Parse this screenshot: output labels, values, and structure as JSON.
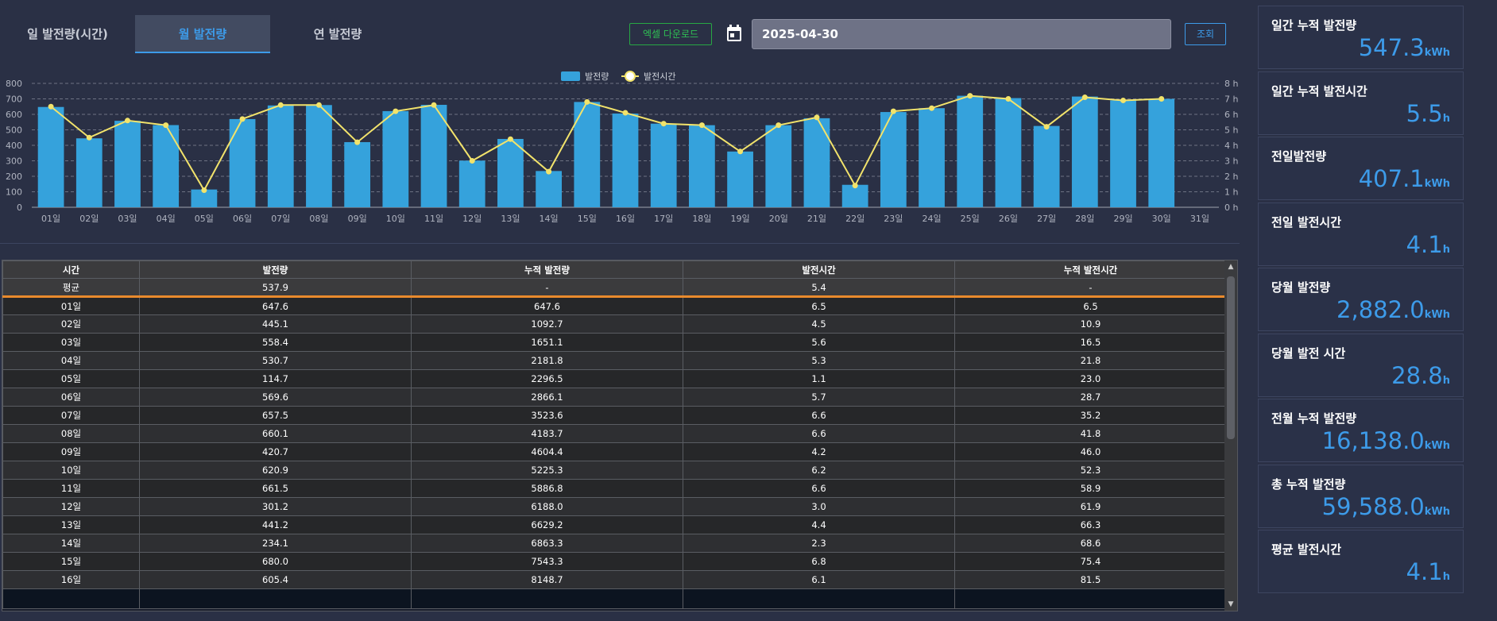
{
  "tabs": [
    "일 발전량(시간)",
    "월 발전량",
    "연 발전량"
  ],
  "toolbar": {
    "excel_label": "엑셀 다운로드",
    "date": "2025-04-30",
    "search_label": "조회"
  },
  "icons": {
    "calendar": "calendar-icon",
    "scroll_up": "chevron-up-icon",
    "scroll_down": "chevron-down-icon"
  },
  "colors": {
    "bar": "#35a2dc",
    "line": "#f2e36b",
    "accent": "#3d9be9",
    "excel": "#27a844",
    "avg_divider": "#e98a2d"
  },
  "chart_data": {
    "type": "bar",
    "categories": [
      "01일",
      "02일",
      "03일",
      "04일",
      "05일",
      "06일",
      "07일",
      "08일",
      "09일",
      "10일",
      "11일",
      "12일",
      "13일",
      "14일",
      "15일",
      "16일",
      "17일",
      "18일",
      "19일",
      "20일",
      "21일",
      "22일",
      "23일",
      "24일",
      "25일",
      "26일",
      "27일",
      "28일",
      "29일",
      "30일",
      "31일"
    ],
    "series": [
      {
        "name": "발전량",
        "kind": "bar",
        "axis": "left",
        "values": [
          647.6,
          445.1,
          558.4,
          530.7,
          114.7,
          569.6,
          657.5,
          660.1,
          420.7,
          620.9,
          661.5,
          301.2,
          441.2,
          234.1,
          680.0,
          605.4,
          540,
          530,
          360,
          530,
          575,
          145,
          615,
          640,
          720,
          705,
          525,
          715,
          690,
          700,
          null
        ]
      },
      {
        "name": "발전시간",
        "kind": "line",
        "axis": "right",
        "values": [
          6.5,
          4.5,
          5.6,
          5.3,
          1.1,
          5.7,
          6.6,
          6.6,
          4.2,
          6.2,
          6.6,
          3.0,
          4.4,
          2.3,
          6.8,
          6.1,
          5.4,
          5.3,
          3.6,
          5.3,
          5.8,
          1.4,
          6.2,
          6.4,
          7.2,
          7.0,
          5.2,
          7.1,
          6.9,
          7.0,
          null
        ]
      }
    ],
    "y_left": {
      "ticks": [
        "0",
        "100",
        "200",
        "300",
        "400",
        "500",
        "600",
        "700",
        "800"
      ],
      "lim": [
        0,
        800
      ]
    },
    "y_right": {
      "ticks": [
        "0 h",
        "1 h",
        "2 h",
        "3 h",
        "4 h",
        "5 h",
        "6 h",
        "7 h",
        "8 h"
      ],
      "lim": [
        0,
        8
      ]
    },
    "legend_position": "top-center",
    "grid": true
  },
  "table": {
    "headers": [
      "시간",
      "발전량",
      "누적 발전량",
      "발전시간",
      "누적 발전시간"
    ],
    "average": [
      "평균",
      "537.9",
      "-",
      "5.4",
      "-"
    ],
    "rows": [
      [
        "01일",
        "647.6",
        "647.6",
        "6.5",
        "6.5"
      ],
      [
        "02일",
        "445.1",
        "1092.7",
        "4.5",
        "10.9"
      ],
      [
        "03일",
        "558.4",
        "1651.1",
        "5.6",
        "16.5"
      ],
      [
        "04일",
        "530.7",
        "2181.8",
        "5.3",
        "21.8"
      ],
      [
        "05일",
        "114.7",
        "2296.5",
        "1.1",
        "23.0"
      ],
      [
        "06일",
        "569.6",
        "2866.1",
        "5.7",
        "28.7"
      ],
      [
        "07일",
        "657.5",
        "3523.6",
        "6.6",
        "35.2"
      ],
      [
        "08일",
        "660.1",
        "4183.7",
        "6.6",
        "41.8"
      ],
      [
        "09일",
        "420.7",
        "4604.4",
        "4.2",
        "46.0"
      ],
      [
        "10일",
        "620.9",
        "5225.3",
        "6.2",
        "52.3"
      ],
      [
        "11일",
        "661.5",
        "5886.8",
        "6.6",
        "58.9"
      ],
      [
        "12일",
        "301.2",
        "6188.0",
        "3.0",
        "61.9"
      ],
      [
        "13일",
        "441.2",
        "6629.2",
        "4.4",
        "66.3"
      ],
      [
        "14일",
        "234.1",
        "6863.3",
        "2.3",
        "68.6"
      ],
      [
        "15일",
        "680.0",
        "7543.3",
        "6.8",
        "75.4"
      ],
      [
        "16일",
        "605.4",
        "8148.7",
        "6.1",
        "81.5"
      ]
    ]
  },
  "summary": [
    {
      "title": "일간 누적 발전량",
      "value": "547.3",
      "unit": "kWh"
    },
    {
      "title": "일간 누적 발전시간",
      "value": "5.5",
      "unit": "h"
    },
    {
      "title": "전일발전량",
      "value": "407.1",
      "unit": "kWh"
    },
    {
      "title": "전일 발전시간",
      "value": "4.1",
      "unit": "h"
    },
    {
      "title": "당월 발전량",
      "value": "2,882.0",
      "unit": "kWh"
    },
    {
      "title": "당월 발전 시간",
      "value": "28.8",
      "unit": "h"
    },
    {
      "title": "전월 누적 발전량",
      "value": "16,138.0",
      "unit": "kWh"
    },
    {
      "title": "총 누적 발전량",
      "value": "59,588.0",
      "unit": "kWh"
    },
    {
      "title": "평균 발전시간",
      "value": "4.1",
      "unit": "h"
    }
  ]
}
